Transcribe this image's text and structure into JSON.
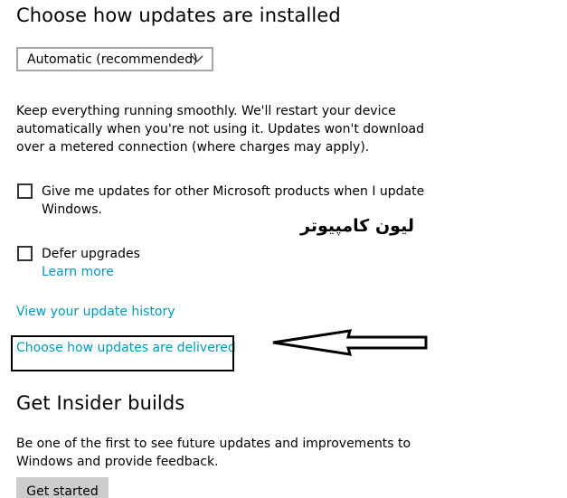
{
  "install_section": {
    "title": "Choose how updates are installed",
    "dropdown_value": "Automatic (recommended)",
    "description": "Keep everything running smoothly. We'll restart your device automatically when you're not using it. Updates won't download over a metered connection (where charges may apply).",
    "description_lines": [
      "Keep everything running smoothly. We'll restart your device",
      "automatically when you're not using it. Updates won't download",
      "over a metered connection (where charges may apply)."
    ]
  },
  "options": {
    "other_products": {
      "checked": false,
      "label_lines": [
        "Give me updates for other Microsoft products when I update",
        "Windows."
      ]
    },
    "defer_upgrades": {
      "checked": false,
      "label": "Defer upgrades",
      "learn_more": "Learn more"
    }
  },
  "links": {
    "history": "View your update history",
    "delivered": "Choose how updates are delivered"
  },
  "annotation": {
    "arabic_text": "لیون کامپیوتر"
  },
  "insider_section": {
    "title": "Get Insider builds",
    "description_lines": [
      "Be one of the first to see future updates and improvements to",
      "Windows and provide feedback."
    ],
    "button": "Get started"
  },
  "colors": {
    "link": "#0099bc",
    "button_bg": "#cccccc",
    "dropdown_border": "#a6a6a6"
  },
  "icons": {
    "dropdown": "chevron-down-icon",
    "annotation": "arrow-left-icon"
  }
}
